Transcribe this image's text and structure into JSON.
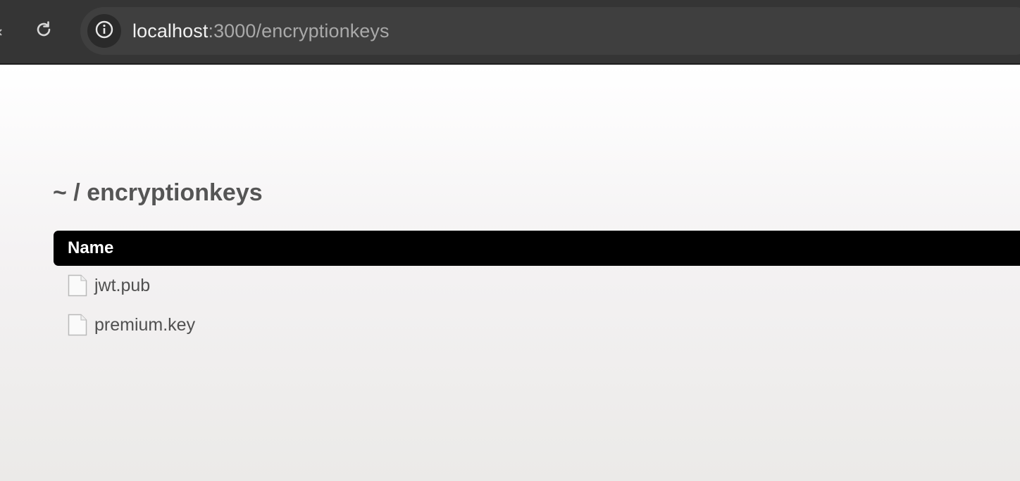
{
  "browser": {
    "url_host": "localhost",
    "url_rest": ":3000/encryptionkeys"
  },
  "page": {
    "breadcrumb": "~ / encryptionkeys",
    "table": {
      "header_name": "Name",
      "files": [
        {
          "name": "jwt.pub",
          "icon": "file-icon"
        },
        {
          "name": "premium.key",
          "icon": "file-icon"
        }
      ]
    }
  },
  "colors": {
    "toolbar_bg": "#353535",
    "address_bar_bg": "#3f3f3f",
    "header_bg": "#000000",
    "text": "#505050"
  }
}
